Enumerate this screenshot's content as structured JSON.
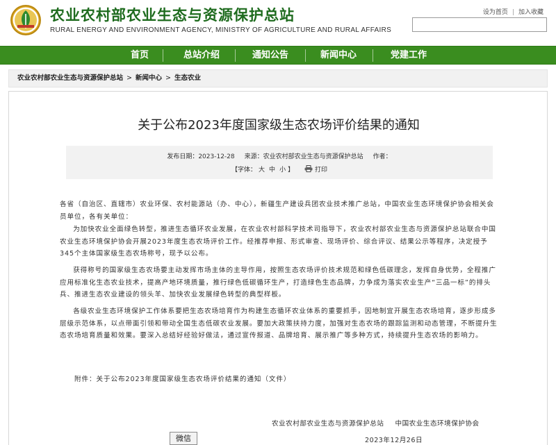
{
  "header": {
    "site_title": "农业农村部农业生态与资源保护总站",
    "site_subtitle": "RURAL ENERGY AND ENVIRONMENT AGENCY, MINISTRY OF AGRICULTURE AND RURAL AFFAIRS",
    "set_home_label": "设为首页",
    "favorite_label": "加入收藏",
    "search_placeholder": "",
    "logo_icon": "agency-emblem-icon"
  },
  "nav": {
    "items": [
      {
        "label": "首页"
      },
      {
        "label": "总站介绍"
      },
      {
        "label": "通知公告"
      },
      {
        "label": "新闻中心"
      },
      {
        "label": "党建工作"
      }
    ],
    "background_color": "#3a8d1f"
  },
  "breadcrumb": {
    "items": [
      "农业农村部农业生态与资源保护总站",
      "新闻中心",
      "生态农业"
    ],
    "separator": ">"
  },
  "article": {
    "title": "关于公布2023年度国家级生态农场评价结果的通知",
    "meta": {
      "date_label": "发布日期：",
      "date_value": "2023-12-28",
      "source_label": "来源：",
      "source_value": "农业农村部农业生态与资源保护总站",
      "author_label": "作者：",
      "author_value": "",
      "font_label": "【字体：",
      "font_large": "大",
      "font_medium": "中",
      "font_small": "小",
      "font_close": "】",
      "print_label": "打印",
      "print_icon": "printer-icon"
    },
    "salutation": "各省（自治区、直辖市）农业环保、农村能源站（办、中心），新疆生产建设兵团农业技术推广总站，中国农业生态环境保护协会相关会员单位，各有关单位：",
    "paragraphs": [
      "为加快农业全面绿色转型，推进生态循环农业发展，在农业农村部科学技术司指导下，农业农村部农业生态与资源保护总站联合中国农业生态环境保护协会开展2023年度生态农场评价工作。经推荐申报、形式审查、现场评价、综合评议、结果公示等程序，决定授予345个主体国家级生态农场称号，现予以公布。",
      "获得称号的国家级生态农场要主动发挥市场主体的主导作用，按照生态农场评价技术规范和绿色低碳理念，发挥自身优势，全程推广应用标准化生态农业技术，提高产地环境质量，推行绿色低碳循环生产，打造绿色生态品牌，力争成为落实农业生产“三品一标”的排头兵、推进生态农业建设的领头羊、加快农业发展绿色转型的典型样板。",
      "各级农业生态环境保护工作体系要把生态农场培育作为构建生态循环农业体系的重要抓手，因地制宜开展生态农场培育，逐步形成多层级示范体系，以点带面引领和带动全国生态低碳农业发展。要加大政策扶持力度，加强对生态农场的跟踪监测和动态管理，不断提升生态农场培育质量和效果。要深入总结好经验好做法，通过宣传报道、品牌培育、展示推广等多种方式，持续提升生态农场的影响力。"
    ],
    "attachment": "附件：关于公布2023年度国家级生态农场评价结果的通知（文件）",
    "signer_1": "农业农村部农业生态与资源保护总站",
    "signer_2": "中国农业生态环境保护协会",
    "sign_date": "2023年12月26日"
  },
  "share": {
    "wechat_label": "微信"
  }
}
